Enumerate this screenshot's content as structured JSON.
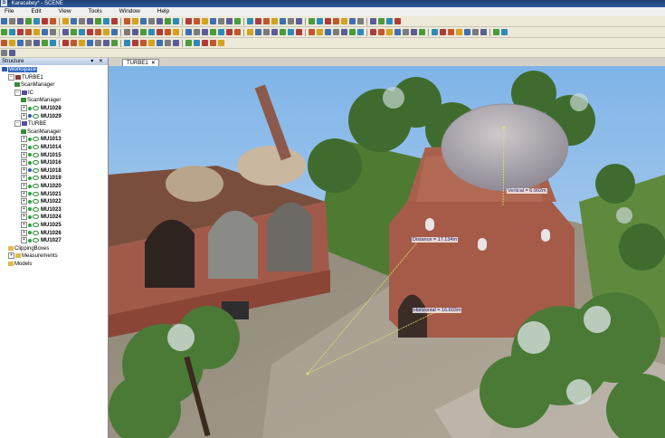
{
  "window": {
    "title": "Karacabey* - SCENE",
    "app_icon": "S"
  },
  "menu": [
    "File",
    "Edit",
    "View",
    "Tools",
    "Window",
    "Help"
  ],
  "panel": {
    "title": "Structure",
    "header_buttons": "▾ ✕"
  },
  "tree": [
    {
      "label": "Workspace",
      "depth": 0,
      "selected": true,
      "expander": "",
      "icon": "workspace"
    },
    {
      "label": "TURBE1",
      "depth": 1,
      "expander": "−",
      "icon": "project"
    },
    {
      "label": "ScanManager",
      "depth": 2,
      "expander": "",
      "icon": "scanmanager"
    },
    {
      "label": "IC",
      "depth": 2,
      "expander": "−",
      "icon": "cluster"
    },
    {
      "label": "ScanManager",
      "depth": 3,
      "expander": "",
      "icon": "scanmanager"
    },
    {
      "label": "MU1028",
      "depth": 3,
      "expander": "+",
      "icon": "scan",
      "bold": true
    },
    {
      "label": "MU1029",
      "depth": 3,
      "expander": "+",
      "icon": "scan-loaded",
      "bold": true
    },
    {
      "label": "TURBE",
      "depth": 2,
      "expander": "−",
      "icon": "cluster"
    },
    {
      "label": "ScanManager",
      "depth": 3,
      "expander": "",
      "icon": "scanmanager"
    },
    {
      "label": "MU1013",
      "depth": 3,
      "expander": "+",
      "icon": "scan",
      "bold": true
    },
    {
      "label": "MU1014",
      "depth": 3,
      "expander": "+",
      "icon": "scan",
      "bold": true
    },
    {
      "label": "MU1015",
      "depth": 3,
      "expander": "+",
      "icon": "scan",
      "bold": true
    },
    {
      "label": "MU1016",
      "depth": 3,
      "expander": "+",
      "icon": "scan",
      "bold": true
    },
    {
      "label": "MU1018",
      "depth": 3,
      "expander": "+",
      "icon": "scan-loaded",
      "bold": true
    },
    {
      "label": "MU1019",
      "depth": 3,
      "expander": "+",
      "icon": "scan",
      "bold": true
    },
    {
      "label": "MU1020",
      "depth": 3,
      "expander": "+",
      "icon": "scan",
      "bold": true
    },
    {
      "label": "MU1021",
      "depth": 3,
      "expander": "+",
      "icon": "scan",
      "bold": true
    },
    {
      "label": "MU1022",
      "depth": 3,
      "expander": "+",
      "icon": "scan",
      "bold": true
    },
    {
      "label": "MU1023",
      "depth": 3,
      "expander": "+",
      "icon": "scan",
      "bold": true
    },
    {
      "label": "MU1024",
      "depth": 3,
      "expander": "+",
      "icon": "scan",
      "bold": true
    },
    {
      "label": "MU1025",
      "depth": 3,
      "expander": "+",
      "icon": "scan",
      "bold": true
    },
    {
      "label": "MU1026",
      "depth": 3,
      "expander": "+",
      "icon": "scan",
      "bold": true
    },
    {
      "label": "MU1027",
      "depth": 3,
      "expander": "+",
      "icon": "scan",
      "bold": true
    },
    {
      "label": "ClippingBoxes",
      "depth": 1,
      "expander": "",
      "icon": "folder"
    },
    {
      "label": "Measurements",
      "depth": 1,
      "expander": "+",
      "icon": "folder"
    },
    {
      "label": "Models",
      "depth": 1,
      "expander": "",
      "icon": "folder"
    }
  ],
  "view": {
    "tab_label": "TURBE1",
    "tab_close": "×",
    "measurements": [
      {
        "label": "Vertical = 6.902m"
      },
      {
        "label": "Distance = 17.134m"
      },
      {
        "label": "Horizontal = 16.603m"
      }
    ]
  },
  "colors": {
    "selection": "#316ac5",
    "title_bar": "#1f3f73",
    "tree_dot": "#25a33a"
  }
}
